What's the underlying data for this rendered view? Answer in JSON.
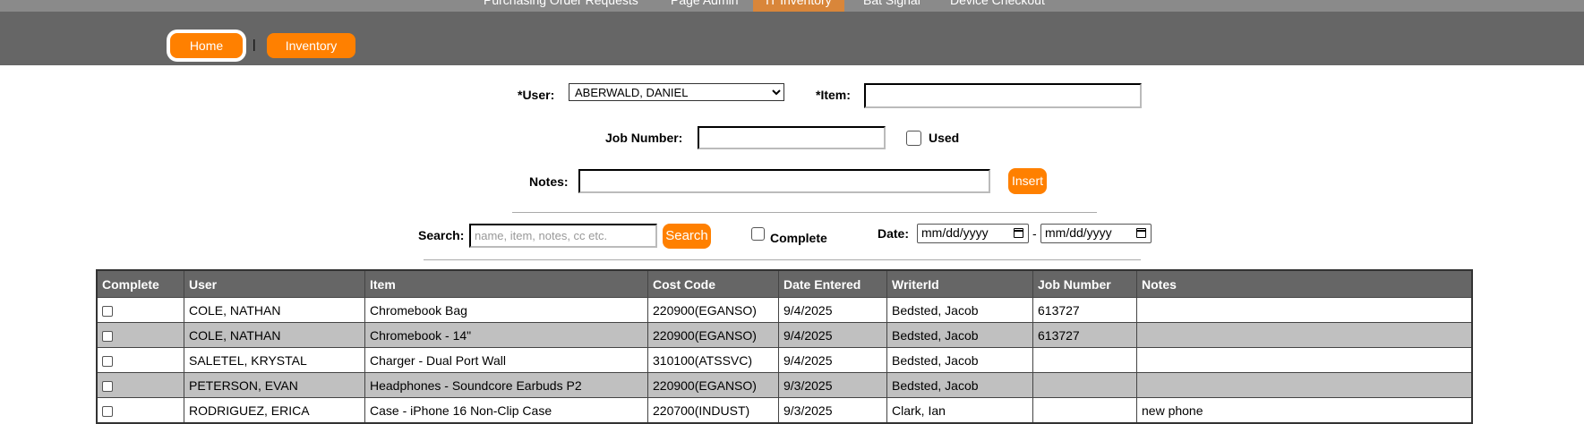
{
  "top_nav": [
    "Purchasing Order Requests",
    "Page Admin",
    "IT Inventory",
    "Bat Signal",
    "Device Checkout"
  ],
  "header": {
    "home_label": "Home",
    "separator": "|",
    "inventory_label": "Inventory"
  },
  "form": {
    "user_label": "*User:",
    "user_value": "ABERWALD, DANIEL",
    "item_label": "*Item:",
    "item_value": "",
    "job_label": "Job Number:",
    "job_value": "",
    "used_label": "Used",
    "notes_label": "Notes:",
    "notes_value": "",
    "insert_label": "Insert"
  },
  "search": {
    "label": "Search:",
    "placeholder": "name, item, notes, cc etc.",
    "button": "Search",
    "complete_label": "Complete",
    "date_label": "Date:",
    "date_from": "mm/dd/yyyy",
    "date_sep": "-",
    "date_to": "mm/dd/yyyy"
  },
  "table": {
    "headers": [
      "Complete",
      "User",
      "Item",
      "Cost Code",
      "Date Entered",
      "WriterId",
      "Job Number",
      "Notes"
    ],
    "rows": [
      {
        "user": "COLE, NATHAN",
        "item": "Chromebook Bag",
        "cost_code": "220900(EGANSO)",
        "date": "9/4/2025",
        "writer": "Bedsted, Jacob",
        "job": "613727",
        "notes": ""
      },
      {
        "user": "COLE, NATHAN",
        "item": "Chromebook - 14\"",
        "cost_code": "220900(EGANSO)",
        "date": "9/4/2025",
        "writer": "Bedsted, Jacob",
        "job": "613727",
        "notes": ""
      },
      {
        "user": "SALETEL, KRYSTAL",
        "item": "Charger - Dual Port Wall",
        "cost_code": "310100(ATSSVC)",
        "date": "9/4/2025",
        "writer": "Bedsted, Jacob",
        "job": "",
        "notes": ""
      },
      {
        "user": "PETERSON, EVAN",
        "item": "Headphones - Soundcore Earbuds P2",
        "cost_code": "220900(EGANSO)",
        "date": "9/3/2025",
        "writer": "Bedsted, Jacob",
        "job": "",
        "notes": ""
      },
      {
        "user": "RODRIGUEZ, ERICA",
        "item": "Case - iPhone 16 Non-Clip Case",
        "cost_code": "220700(INDUST)",
        "date": "9/3/2025",
        "writer": "Clark, Ian",
        "job": "",
        "notes": "new phone"
      }
    ]
  },
  "colors": {
    "accent": "#ff8000",
    "header_bg": "#666666",
    "alt_row": "#c0c0c0",
    "active_tab": "#d9863a"
  }
}
